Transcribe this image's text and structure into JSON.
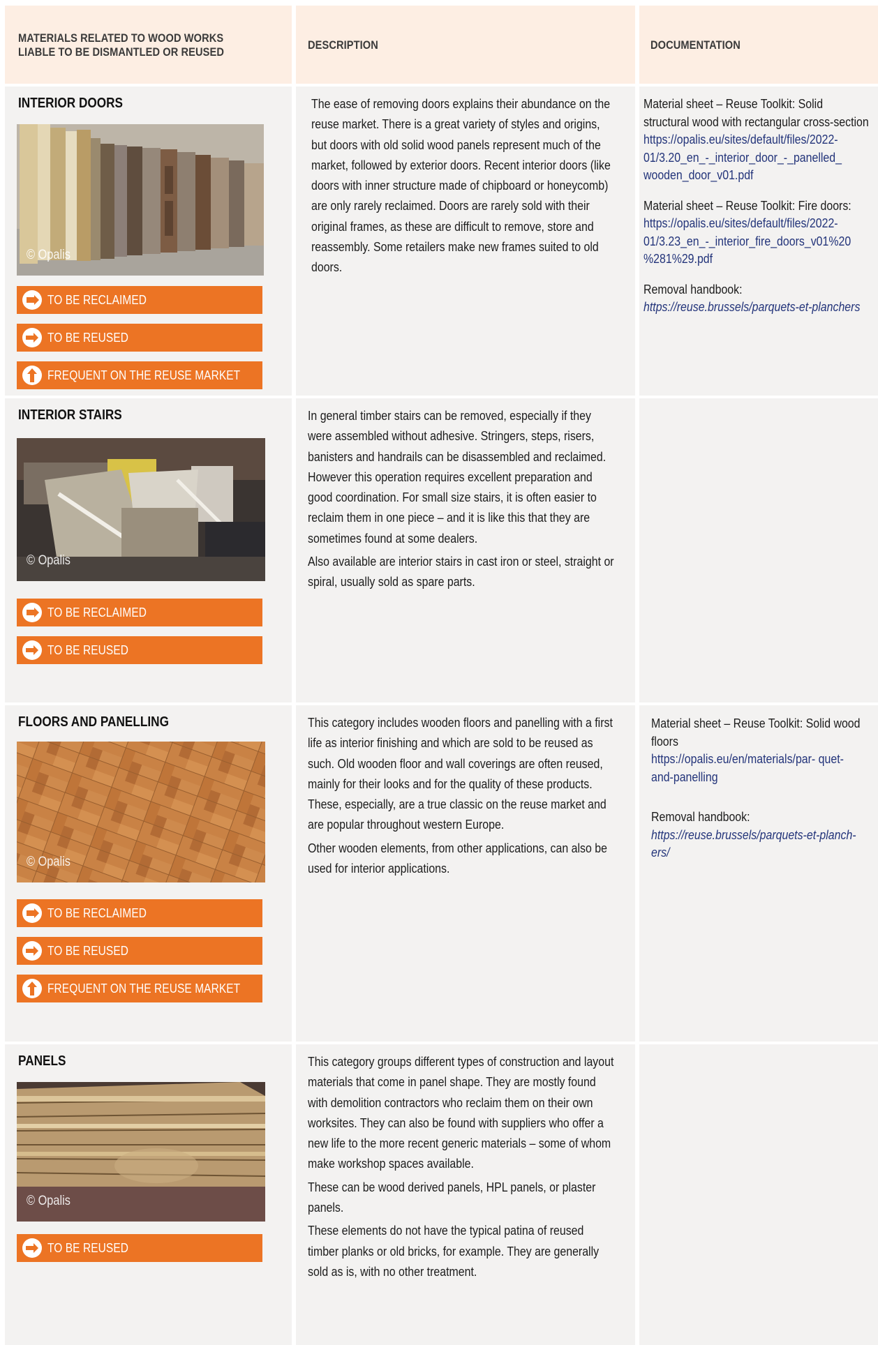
{
  "header": {
    "col1": "MATERIALS RELATED TO WOOD WORKS LIABLE TO BE DISMANTLED OR REUSED",
    "col2": "DESCRIPTION",
    "col3": "DOCUMENTATION"
  },
  "tags": {
    "reclaimed": "TO BE RECLAIMED",
    "reused": "TO BE REUSED",
    "frequent": "FREQUENT ON THE REUSE MARKET"
  },
  "credit": "© Opalis",
  "rows": [
    {
      "title": "INTERIOR DOORS",
      "description": [
        "The ease of removing doors explains their abundance on the reuse market. There is a great variety of styles and origins, but doors with old solid wood panels represent much of the market, followed by exterior doors. Recent interior doors (like doors with inner structure made of chipboard or honeycomb) are only rarely reclaimed. Doors are rarely sold with their original frames, as these are difficult to remove, store and reassembly. Some retailers make new frames suited to old doors."
      ],
      "docs": [
        {
          "lead": "Material sheet – Reuse Toolkit: Solid structural wood with rectangular cross-section",
          "link": "https://opalis.eu/sites/default/files/2022-01/3.20_en_-_interior_door_-_panelled_ wooden_door_v01.pdf"
        },
        {
          "lead": "Material sheet – Reuse Toolkit: Fire doors:",
          "link": "https://opalis.eu/sites/default/files/2022-01/3.23_en_-_interior_fire_doors_v01%20 %281%29.pdf"
        },
        {
          "lead": "Removal handbook:",
          "link": "https://reuse.brussels/parquets-et-planchers"
        }
      ]
    },
    {
      "title": "INTERIOR STAIRS",
      "description": [
        "In general timber stairs can be removed, especially if they were assembled without adhesive. Stringers, steps, risers, banisters and handrails can be disassembled and reclaimed. However this operation requires excellent preparation and good coordination. For small size stairs, it is often easier to reclaim them in one piece – and it is like this that they are sometimes found at some dealers.",
        "Also available are interior stairs in cast iron or steel, straight or spiral, usually sold as spare parts."
      ]
    },
    {
      "title": "FLOORS AND PANELLING",
      "description": [
        "This category includes wooden floors and panelling with a first life as interior finishing and which are sold to be reused as such. Old wooden floor and wall coverings are often reused, mainly for their looks and for the quality of these products. These, especially, are a true classic on the reuse market and are popular throughout western Europe.",
        "Other wooden elements, from other applications, can also be used for interior applications."
      ],
      "docs": [
        {
          "lead": "Material sheet – Reuse Toolkit: Solid wood floors",
          "link": "https://opalis.eu/en/materials/par- quet-and-panelling"
        },
        {
          "lead": "Removal handbook:",
          "link": "https://reuse.brussels/parquets-et-planch- ers/"
        }
      ]
    },
    {
      "title": "PANELS",
      "description": [
        "This category groups different types of construction and layout materials that come in panel shape. They are mostly found with demolition contractors who reclaim them on their own worksites. They can also be found with suppliers who offer a new life to the more recent generic materials – some of whom make workshop spaces available.",
        "These can be wood derived panels, HPL panels, or plaster panels.",
        "These elements do not have the typical patina of reused timber planks or old bricks, for example. They are generally sold as is, with no other treatment."
      ]
    }
  ],
  "colors": {
    "tag": "#ec7424",
    "header_bg": "#fdeee3",
    "cell_bg": "#f3f2f1",
    "link": "#23347a"
  }
}
